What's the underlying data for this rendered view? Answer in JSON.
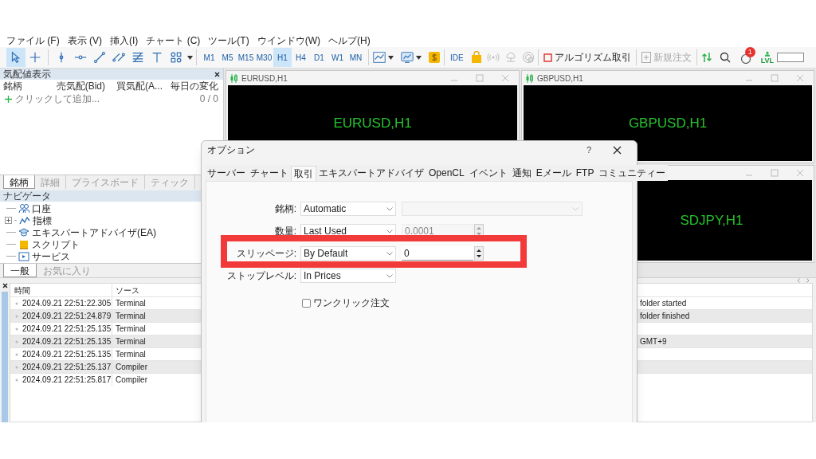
{
  "menu_bar": [
    "ファイル (F)",
    "表示 (V)",
    "挿入(I)",
    "チャート (C)",
    "ツール(T)",
    "ウインドウ(W)",
    "ヘルプ(H)"
  ],
  "toolbar": {
    "drawing_tools": [
      {
        "kind": "cursor",
        "selected": true
      },
      {
        "kind": "crosshair",
        "selected": false
      },
      {
        "kind": "vline",
        "selected": false
      },
      {
        "kind": "hline",
        "selected": false
      },
      {
        "kind": "trendline",
        "selected": false
      },
      {
        "kind": "channel",
        "selected": false
      },
      {
        "kind": "fibo",
        "selected": false
      },
      {
        "kind": "text",
        "selected": false
      },
      {
        "kind": "shapes",
        "selected": false
      }
    ],
    "timeframes": [
      {
        "label": "M1",
        "selected": false
      },
      {
        "label": "M5",
        "selected": false
      },
      {
        "label": "M15",
        "selected": false
      },
      {
        "label": "M30",
        "selected": false
      },
      {
        "label": "H1",
        "selected": true
      },
      {
        "label": "H4",
        "selected": false
      },
      {
        "label": "D1",
        "selected": false
      },
      {
        "label": "W1",
        "selected": false
      },
      {
        "label": "MN",
        "selected": false
      }
    ],
    "ide": "IDE",
    "algo_trading": {
      "label": "アルゴリズム取引",
      "on": false
    },
    "new_order": {
      "label": "新規注文",
      "disabled": true
    },
    "notification_count": "1",
    "lvl": "LVL"
  },
  "market_watch": {
    "title": "気配値表示",
    "columns": [
      "銘柄",
      "売気配(Bid)",
      "買気配(A...",
      "毎日の変化"
    ],
    "add_row": {
      "label": "クリックして追加...",
      "count": "0 / 0"
    },
    "tabs": [
      {
        "label": "銘柄",
        "selected": true
      },
      {
        "label": "詳細",
        "selected": false
      },
      {
        "label": "プライスボード",
        "selected": false
      },
      {
        "label": "ティック",
        "selected": false
      }
    ]
  },
  "navigator": {
    "title": "ナビゲータ",
    "items": [
      {
        "kind": "accounts",
        "label": "口座"
      },
      {
        "kind": "indicators",
        "label": "指標",
        "expanded": false
      },
      {
        "kind": "experts",
        "label": "エキスパートアドバイザ(EA)"
      },
      {
        "kind": "scripts",
        "label": "スクリプト"
      },
      {
        "kind": "services",
        "label": "サービス"
      }
    ],
    "tabs": [
      {
        "label": "一般",
        "selected": true
      },
      {
        "label": "お気に入り",
        "selected": false
      }
    ]
  },
  "charts": [
    {
      "title": "EURUSD,H1",
      "label": "EURUSD,H1"
    },
    {
      "title": "GBPUSD,H1",
      "label": "GBPUSD,H1"
    },
    {
      "label": "SDJPY,H1"
    }
  ],
  "toolbox": {
    "columns": [
      "時間",
      "ソース"
    ],
    "rows": [
      {
        "time": "2024.09.21 22:51:22.305",
        "source": "Terminal",
        "message": "folder started"
      },
      {
        "time": "2024.09.21 22:51:24.879",
        "source": "Terminal",
        "message": "folder finished"
      },
      {
        "time": "2024.09.21 22:51:25.135",
        "source": "Terminal"
      },
      {
        "time": "2024.09.21 22:51:25.135",
        "source": "Terminal",
        "message": "GMT+9"
      },
      {
        "time": "2024.09.21 22:51:25.135",
        "source": "Terminal"
      },
      {
        "time": "2024.09.21 22:51:25.137",
        "source": "Compiler"
      },
      {
        "time": "2024.09.21 22:51:25.817",
        "source": "Compiler"
      }
    ]
  },
  "dialog": {
    "title": "オプション",
    "help": "?",
    "tabs": [
      {
        "label": "サーバー",
        "selected": false
      },
      {
        "label": "チャート",
        "selected": false
      },
      {
        "label": "取引",
        "selected": true
      },
      {
        "label": "エキスパートアドバイザ",
        "selected": false
      },
      {
        "label": "OpenCL",
        "selected": false
      },
      {
        "label": "イベント",
        "selected": false
      },
      {
        "label": "通知",
        "selected": false
      },
      {
        "label": "Eメール",
        "selected": false
      },
      {
        "label": "FTP",
        "selected": false
      },
      {
        "label": "コミュニティー",
        "selected": false
      }
    ],
    "fields": [
      {
        "label": "銘柄:",
        "value": "Automatic",
        "highlighted": false,
        "extra": {
          "kind": "select",
          "disabled": true
        }
      },
      {
        "label": "数量:",
        "value": "Last Used",
        "highlighted": false,
        "extra": {
          "kind": "spin",
          "value": "0.0001",
          "disabled": true
        }
      },
      {
        "label": "スリッページ:",
        "value": "By Default",
        "highlighted": true,
        "extra": {
          "kind": "spin",
          "value": "0",
          "disabled": false
        }
      },
      {
        "label": "ストップレベル:",
        "value": "In Prices",
        "highlighted": false
      }
    ],
    "checkbox": {
      "label": "ワンクリック注文",
      "checked": false
    }
  }
}
